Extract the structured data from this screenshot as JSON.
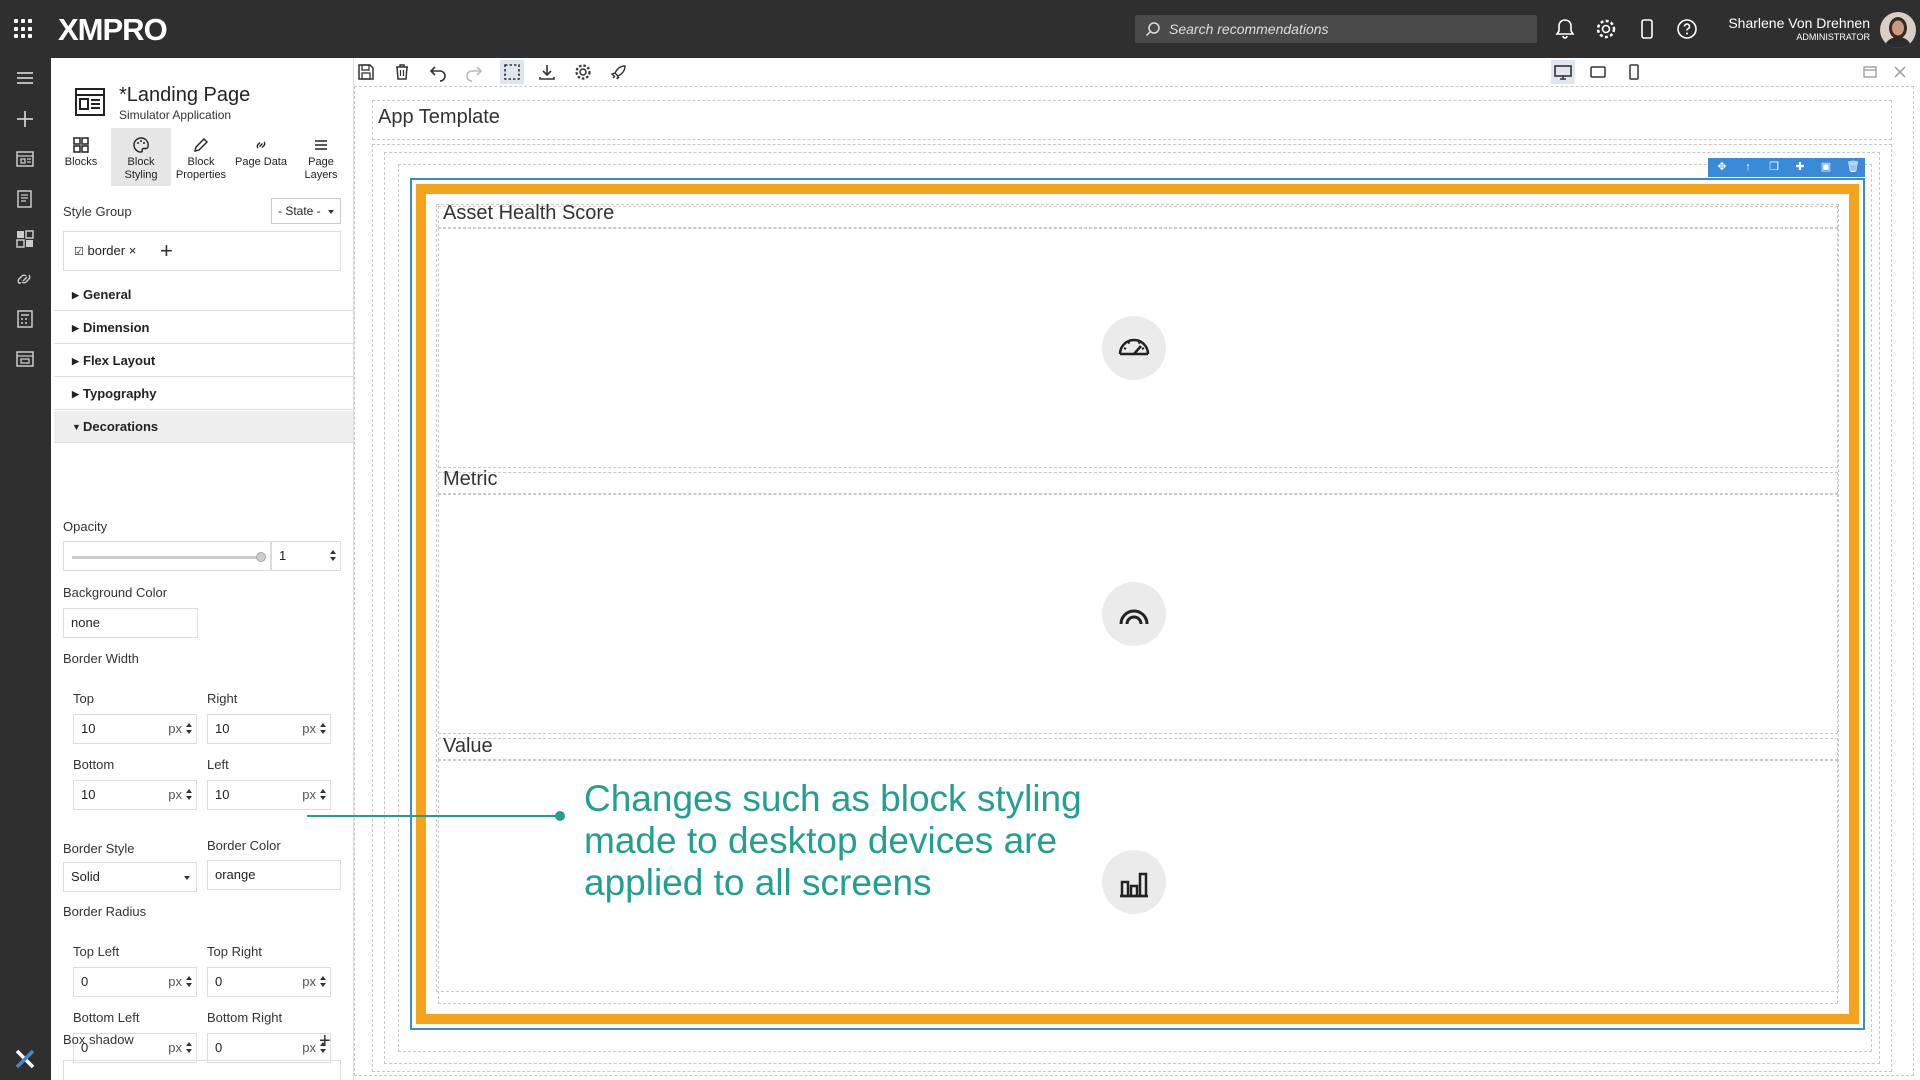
{
  "topbar": {
    "logo": "XMPRO",
    "search_placeholder": "Search recommendations",
    "user_name": "Sharlene Von Drehnen",
    "user_role": "ADMINISTRATOR"
  },
  "panel": {
    "page_title": "*Landing Page",
    "page_subtitle": "Simulator Application",
    "tabs": [
      {
        "label": "Blocks"
      },
      {
        "label": "Block Styling"
      },
      {
        "label": "Block Properties"
      },
      {
        "label": "Page Data"
      },
      {
        "label": "Page Layers"
      }
    ],
    "style_group_label": "Style Group",
    "state_select": "- State -",
    "tag": "border",
    "sections": {
      "general": "General",
      "dimension": "Dimension",
      "flex_layout": "Flex Layout",
      "typography": "Typography",
      "decorations": "Decorations"
    },
    "opacity_label": "Opacity",
    "opacity_value": "1",
    "background_color_label": "Background Color",
    "background_color_value": "none",
    "border_width_label": "Border Width",
    "border_width": {
      "top_label": "Top",
      "top_value": "10",
      "right_label": "Right",
      "right_value": "10",
      "bottom_label": "Bottom",
      "bottom_value": "10",
      "left_label": "Left",
      "left_value": "10",
      "unit": "px"
    },
    "border_style_label": "Border Style",
    "border_style_value": "Solid",
    "border_color_label": "Border Color",
    "border_color_value": "orange",
    "border_radius_label": "Border Radius",
    "border_radius": {
      "top_left_label": "Top Left",
      "top_left_value": "0",
      "top_right_label": "Top Right",
      "top_right_value": "0",
      "bottom_left_label": "Bottom Left",
      "bottom_left_value": "0",
      "bottom_right_label": "Bottom Right",
      "bottom_right_value": "0",
      "unit": "px"
    },
    "box_shadow_label": "Box shadow"
  },
  "canvas": {
    "app_template_label": "App Template",
    "blocks": [
      {
        "title": "Asset Health Score",
        "icon": "gauge-icon"
      },
      {
        "title": "Metric",
        "icon": "arc-gauge-icon"
      },
      {
        "title": "Value",
        "icon": "bar-chart-icon"
      }
    ],
    "accent_border_color": "#f5a31a",
    "selection_color": "#3b8ad8"
  },
  "callout": {
    "text": "Changes such as block styling made to desktop devices are applied to all screens",
    "color": "#22a08d"
  }
}
